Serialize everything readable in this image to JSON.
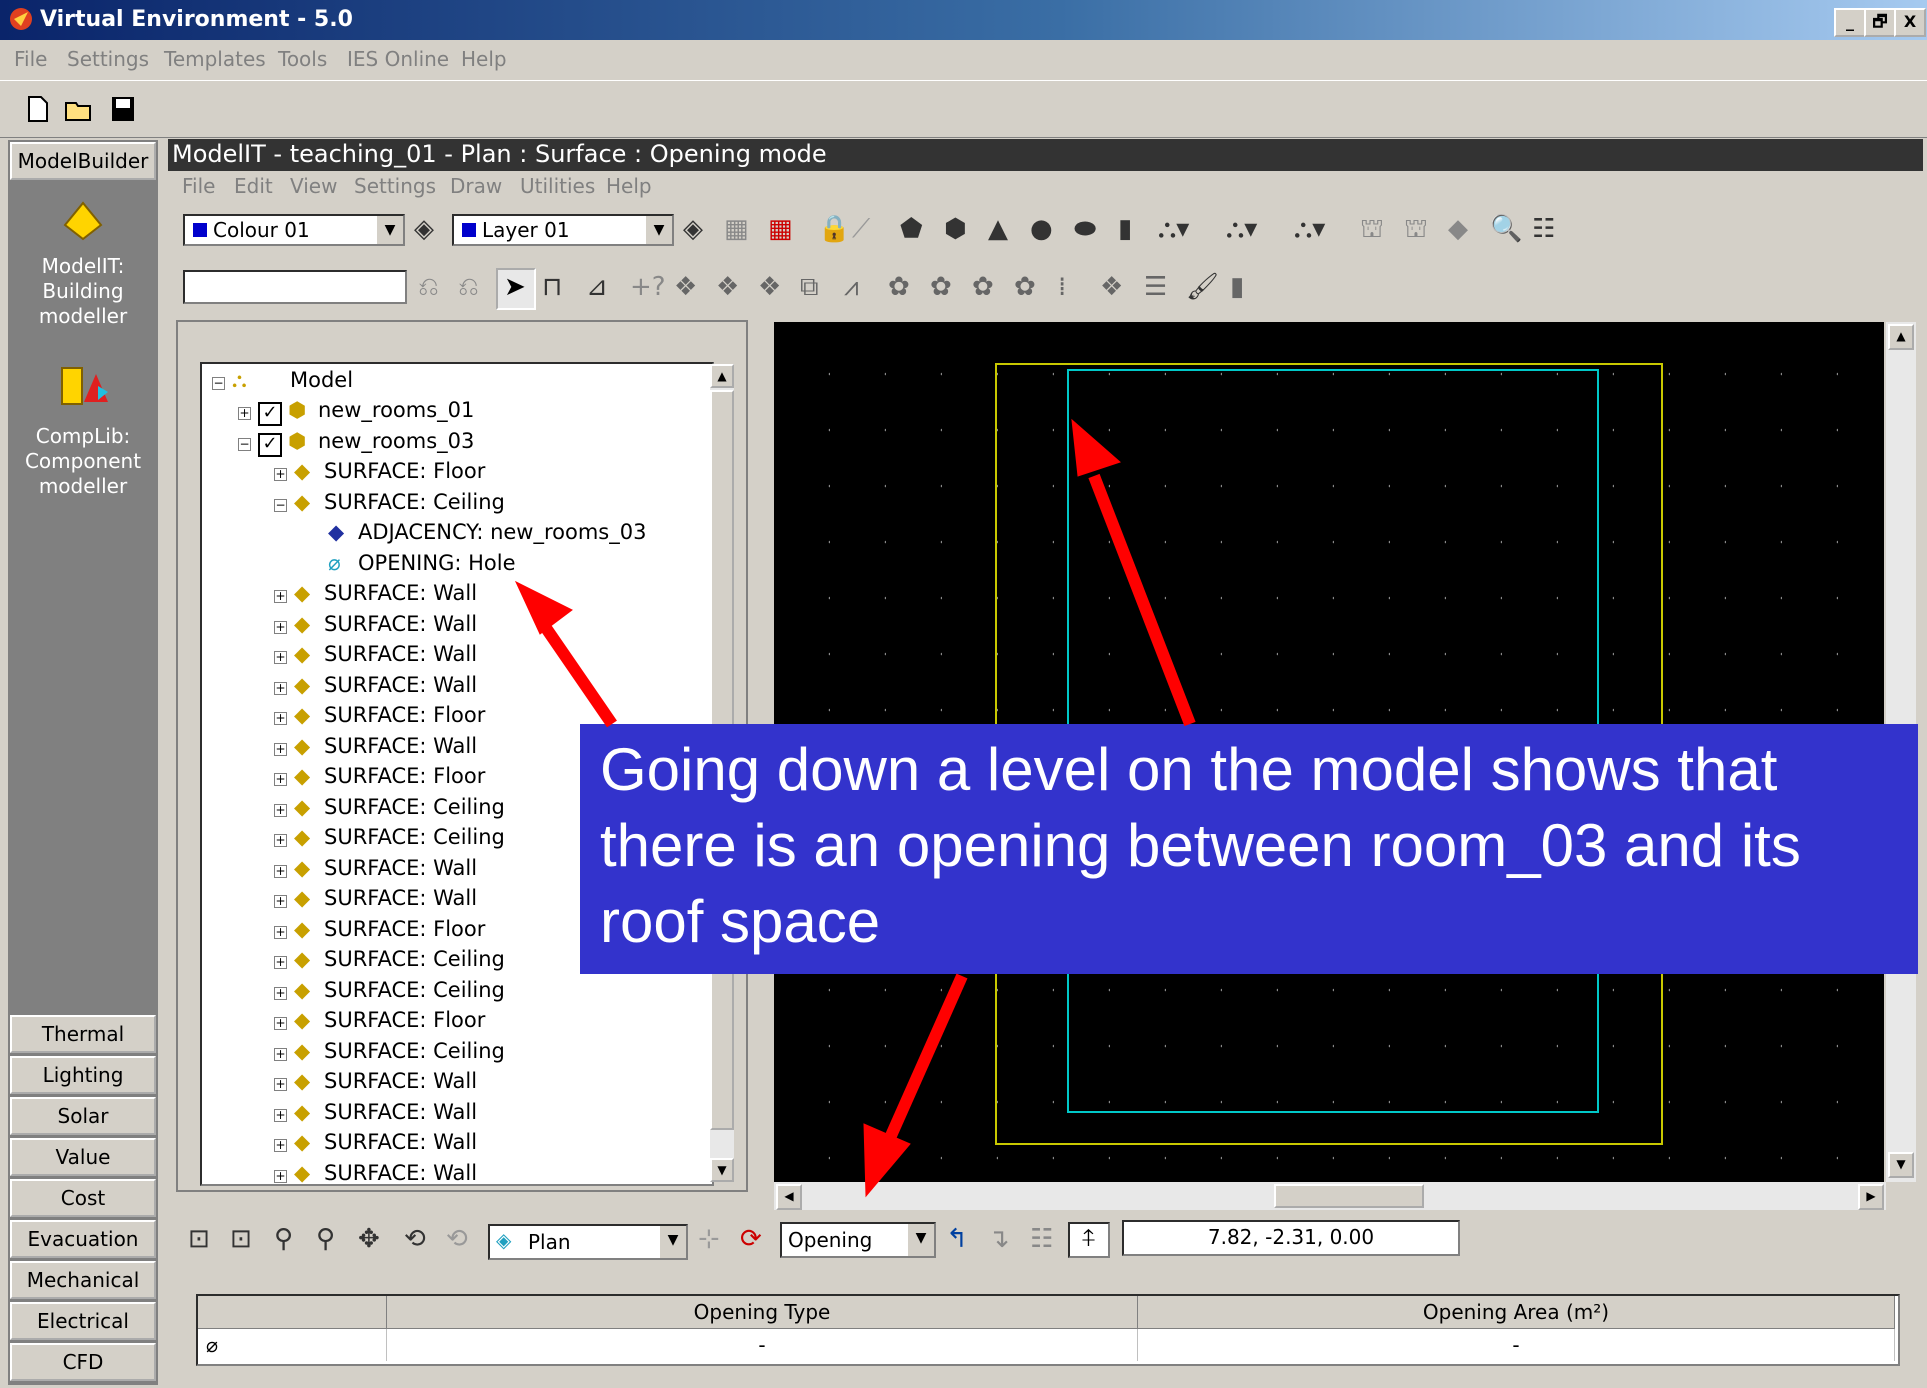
{
  "window": {
    "title": "Virtual Environment - 5.0",
    "buttons": [
      "_",
      "🗗",
      "X"
    ]
  },
  "app_menu": [
    "File",
    "Settings",
    "Templates",
    "Tools",
    "IES Online",
    "Help"
  ],
  "left_panel": {
    "top_tab": "ModelBuilder",
    "tools": [
      {
        "icon": "building-modeller-icon",
        "label_lines": [
          "ModelIT:",
          "Building",
          "modeller"
        ]
      },
      {
        "icon": "component-modeller-icon",
        "label_lines": [
          "CompLib:",
          "Component",
          "modeller"
        ]
      }
    ],
    "tabs": [
      "Thermal",
      "Lighting",
      "Solar",
      "Value",
      "Cost",
      "Evacuation",
      "Mechanical",
      "Electrical",
      "CFD"
    ]
  },
  "inner_window": {
    "title": "ModelIT - teaching_01 - Plan : Surface : Opening mode",
    "menu": [
      "File",
      "Edit",
      "View",
      "Settings",
      "Draw",
      "Utilities",
      "Help"
    ],
    "colour_combo": "Colour 01",
    "layer_combo": "Layer 01",
    "name_input": ""
  },
  "tree": {
    "root": "Model",
    "items": [
      {
        "level": 1,
        "expander": "+",
        "check": true,
        "label": "new_rooms_01",
        "icon": "room-icon"
      },
      {
        "level": 1,
        "expander": "-",
        "check": true,
        "label": "new_rooms_03",
        "icon": "room-icon"
      },
      {
        "level": 2,
        "expander": "+",
        "label": "SURFACE: Floor",
        "icon": "surface-icon"
      },
      {
        "level": 2,
        "expander": "-",
        "label": "SURFACE: Ceiling",
        "icon": "surface-icon"
      },
      {
        "level": 3,
        "expander": "",
        "label": "ADJACENCY: new_rooms_03",
        "icon": "adjacency-icon"
      },
      {
        "level": 3,
        "expander": "",
        "label": "OPENING: Hole",
        "icon": "opening-icon"
      },
      {
        "level": 2,
        "expander": "+",
        "label": "SURFACE: Wall",
        "icon": "surface-icon"
      },
      {
        "level": 2,
        "expander": "+",
        "label": "SURFACE: Wall",
        "icon": "surface-icon"
      },
      {
        "level": 2,
        "expander": "+",
        "label": "SURFACE: Wall",
        "icon": "surface-icon"
      },
      {
        "level": 2,
        "expander": "+",
        "label": "SURFACE: Wall",
        "icon": "surface-icon"
      },
      {
        "level": 2,
        "expander": "+",
        "label": "SURFACE: Floor",
        "icon": "surface-icon"
      },
      {
        "level": 2,
        "expander": "+",
        "label": "SURFACE: Wall",
        "icon": "surface-icon"
      },
      {
        "level": 2,
        "expander": "+",
        "label": "SURFACE: Floor",
        "icon": "surface-icon"
      },
      {
        "level": 2,
        "expander": "+",
        "label": "SURFACE: Ceiling",
        "icon": "surface-icon"
      },
      {
        "level": 2,
        "expander": "+",
        "label": "SURFACE: Ceiling",
        "icon": "surface-icon"
      },
      {
        "level": 2,
        "expander": "+",
        "label": "SURFACE: Wall",
        "icon": "surface-icon"
      },
      {
        "level": 2,
        "expander": "+",
        "label": "SURFACE: Wall",
        "icon": "surface-icon"
      },
      {
        "level": 2,
        "expander": "+",
        "label": "SURFACE: Floor",
        "icon": "surface-icon"
      },
      {
        "level": 2,
        "expander": "+",
        "label": "SURFACE: Ceiling",
        "icon": "surface-icon"
      },
      {
        "level": 2,
        "expander": "+",
        "label": "SURFACE: Ceiling",
        "icon": "surface-icon"
      },
      {
        "level": 2,
        "expander": "+",
        "label": "SURFACE: Floor",
        "icon": "surface-icon"
      },
      {
        "level": 2,
        "expander": "+",
        "label": "SURFACE: Ceiling",
        "icon": "surface-icon"
      },
      {
        "level": 2,
        "expander": "+",
        "label": "SURFACE: Wall",
        "icon": "surface-icon"
      },
      {
        "level": 2,
        "expander": "+",
        "label": "SURFACE: Wall",
        "icon": "surface-icon"
      },
      {
        "level": 2,
        "expander": "+",
        "label": "SURFACE: Wall",
        "icon": "surface-icon"
      },
      {
        "level": 2,
        "expander": "+",
        "label": "SURFACE: Wall",
        "icon": "surface-icon"
      }
    ]
  },
  "status": {
    "view_combo": "Plan",
    "mode_combo": "Opening",
    "coords": "7.82,  -2.31,  0.00"
  },
  "opening_table": {
    "headers": [
      "",
      "Opening Type",
      "Opening Area (m²)"
    ],
    "row": [
      "",
      "-",
      "-"
    ]
  },
  "callout": {
    "text": "Going down a level on the model shows that there is an opening between room_03 and its roof space"
  },
  "colors": {
    "title_gradient_start": "#0a246a",
    "callout_bg": "#3333cc",
    "arrow": "#ff0000",
    "outer_rect": "#c8c800",
    "inner_rect": "#00c8c8"
  }
}
